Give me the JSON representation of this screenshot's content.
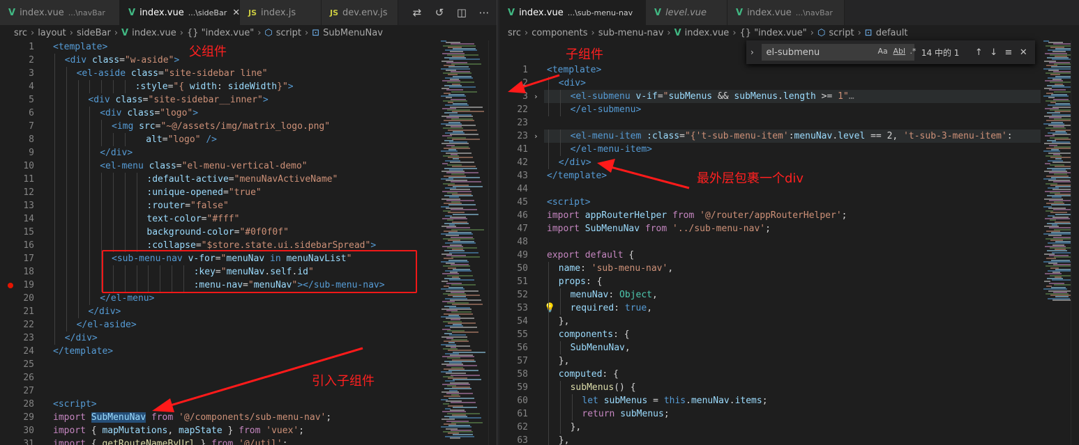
{
  "left": {
    "tabs": [
      {
        "name": "index.vue",
        "desc": "...\\navBar",
        "icon": "vue-icon",
        "active": false
      },
      {
        "name": "index.vue",
        "desc": "...\\sideBar",
        "icon": "vue-icon",
        "active": true,
        "close": "✕"
      },
      {
        "name": "index.js",
        "desc": "",
        "icon": "js-icon",
        "active": false
      },
      {
        "name": "dev.env.js",
        "desc": "",
        "icon": "js-icon",
        "active": false
      }
    ],
    "breadcrumb": [
      "src",
      "layout",
      "sideBar",
      "index.vue",
      "{} \"index.vue\"",
      "script",
      "SubMenuNav"
    ],
    "annotations": {
      "parent": "父组件",
      "import_child": "引入子组件"
    },
    "lines": [
      {
        "n": "1",
        "indent": 0,
        "tokens": [
          [
            "t-tag",
            "<template>"
          ]
        ]
      },
      {
        "n": "2",
        "indent": 1,
        "tokens": [
          [
            "t-tag",
            "<div "
          ],
          [
            "t-attr",
            "class"
          ],
          [
            "t-txt",
            "="
          ],
          [
            "t-str",
            "\"w-aside\""
          ],
          [
            "t-tag",
            ">"
          ]
        ]
      },
      {
        "n": "3",
        "indent": 2,
        "tokens": [
          [
            "t-tag",
            "<el-aside "
          ],
          [
            "t-attr",
            "class"
          ],
          [
            "t-txt",
            "="
          ],
          [
            "t-str",
            "\"site-sidebar line\""
          ]
        ]
      },
      {
        "n": "4",
        "indent": 7,
        "tokens": [
          [
            "t-attr",
            ":style"
          ],
          [
            "t-txt",
            "="
          ],
          [
            "t-str",
            "\"{ "
          ],
          [
            "t-id",
            "width"
          ],
          [
            "t-txt",
            ": "
          ],
          [
            "t-id",
            "sideWidth"
          ],
          [
            "t-str",
            "}\""
          ],
          [
            "t-tag",
            ">"
          ]
        ]
      },
      {
        "n": "5",
        "indent": 3,
        "tokens": [
          [
            "t-tag",
            "<div "
          ],
          [
            "t-attr",
            "class"
          ],
          [
            "t-txt",
            "="
          ],
          [
            "t-str",
            "\"site-sidebar__inner\""
          ],
          [
            "t-tag",
            ">"
          ]
        ]
      },
      {
        "n": "6",
        "indent": 4,
        "tokens": [
          [
            "t-tag",
            "<div "
          ],
          [
            "t-attr",
            "class"
          ],
          [
            "t-txt",
            "="
          ],
          [
            "t-str",
            "\"logo\""
          ],
          [
            "t-tag",
            ">"
          ]
        ]
      },
      {
        "n": "7",
        "indent": 5,
        "tokens": [
          [
            "t-tag",
            "<img "
          ],
          [
            "t-attr",
            "src"
          ],
          [
            "t-txt",
            "="
          ],
          [
            "t-str",
            "\"~@/assets/img/matrix_logo.png\""
          ]
        ]
      },
      {
        "n": "8",
        "indent": 7,
        "tokens": [
          [
            "t-attr",
            "  alt"
          ],
          [
            "t-txt",
            "="
          ],
          [
            "t-str",
            "\"logo\""
          ],
          [
            "t-tag",
            " />"
          ]
        ]
      },
      {
        "n": "9",
        "indent": 4,
        "tokens": [
          [
            "t-tag",
            "</div>"
          ]
        ]
      },
      {
        "n": "10",
        "indent": 4,
        "tokens": [
          [
            "t-tag",
            "<el-menu "
          ],
          [
            "t-attr",
            "class"
          ],
          [
            "t-txt",
            "="
          ],
          [
            "t-str",
            "\"el-menu-vertical-demo\""
          ]
        ]
      },
      {
        "n": "11",
        "indent": 8,
        "tokens": [
          [
            "t-attr",
            ":default-active"
          ],
          [
            "t-txt",
            "="
          ],
          [
            "t-str",
            "\"menuNavActiveName\""
          ]
        ]
      },
      {
        "n": "12",
        "indent": 8,
        "tokens": [
          [
            "t-attr",
            ":unique-opened"
          ],
          [
            "t-txt",
            "="
          ],
          [
            "t-str",
            "\"true\""
          ]
        ]
      },
      {
        "n": "13",
        "indent": 8,
        "tokens": [
          [
            "t-attr",
            ":router"
          ],
          [
            "t-txt",
            "="
          ],
          [
            "t-str",
            "\"false\""
          ]
        ]
      },
      {
        "n": "14",
        "indent": 8,
        "tokens": [
          [
            "t-attr",
            "text-color"
          ],
          [
            "t-txt",
            "="
          ],
          [
            "t-str",
            "\"#fff\""
          ]
        ]
      },
      {
        "n": "15",
        "indent": 8,
        "tokens": [
          [
            "t-attr",
            "background-color"
          ],
          [
            "t-txt",
            "="
          ],
          [
            "t-str",
            "\"#0f0f0f\""
          ]
        ]
      },
      {
        "n": "16",
        "indent": 8,
        "tokens": [
          [
            "t-attr",
            ":collapse"
          ],
          [
            "t-txt",
            "="
          ],
          [
            "t-str",
            "\"$store.state.ui.sidebarSpread\""
          ],
          [
            "t-tag",
            ">"
          ]
        ]
      },
      {
        "n": "17",
        "indent": 5,
        "tokens": [
          [
            "t-tag",
            "<sub-menu-nav "
          ],
          [
            "t-attr",
            "v-for"
          ],
          [
            "t-txt",
            "="
          ],
          [
            "t-str",
            "\""
          ],
          [
            "t-id",
            "menuNav"
          ],
          [
            "t-kw2",
            " in "
          ],
          [
            "t-id",
            "menuNavList"
          ],
          [
            "t-str",
            "\""
          ]
        ]
      },
      {
        "n": "18",
        "indent": 12,
        "tokens": [
          [
            "t-attr",
            ":key"
          ],
          [
            "t-txt",
            "="
          ],
          [
            "t-str",
            "\""
          ],
          [
            "t-id",
            "menuNav"
          ],
          [
            "t-txt",
            "."
          ],
          [
            "t-id",
            "self"
          ],
          [
            "t-txt",
            "."
          ],
          [
            "t-id",
            "id"
          ],
          [
            "t-str",
            "\""
          ]
        ]
      },
      {
        "n": "19",
        "indent": 12,
        "tokens": [
          [
            "t-attr",
            ":menu-nav"
          ],
          [
            "t-txt",
            "="
          ],
          [
            "t-str",
            "\""
          ],
          [
            "t-id",
            "menuNav"
          ],
          [
            "t-str",
            "\""
          ],
          [
            "t-tag",
            "></sub-menu-nav>"
          ]
        ]
      },
      {
        "n": "20",
        "indent": 4,
        "tokens": [
          [
            "t-tag",
            "</el-menu>"
          ]
        ]
      },
      {
        "n": "21",
        "indent": 3,
        "tokens": [
          [
            "t-tag",
            "</div>"
          ]
        ]
      },
      {
        "n": "22",
        "indent": 2,
        "tokens": [
          [
            "t-tag",
            "</el-aside>"
          ]
        ]
      },
      {
        "n": "23",
        "indent": 1,
        "tokens": [
          [
            "t-tag",
            "</div>"
          ]
        ]
      },
      {
        "n": "24",
        "indent": 0,
        "tokens": [
          [
            "t-tag",
            "</template>"
          ]
        ]
      },
      {
        "n": "25",
        "indent": 0,
        "tokens": []
      },
      {
        "n": "26",
        "indent": 0,
        "tokens": []
      },
      {
        "n": "27",
        "indent": 0,
        "tokens": []
      },
      {
        "n": "28",
        "indent": 0,
        "tokens": [
          [
            "t-tag",
            "<script>"
          ]
        ]
      },
      {
        "n": "29",
        "indent": 0,
        "tokens": [
          [
            "t-kw",
            "import "
          ],
          [
            "t-id sel",
            "SubMenuNav"
          ],
          [
            "t-kw",
            " from "
          ],
          [
            "t-str",
            "'@/components/sub-menu-nav'"
          ],
          [
            "t-txt",
            ";"
          ]
        ]
      },
      {
        "n": "30",
        "indent": 0,
        "tokens": [
          [
            "t-kw",
            "import "
          ],
          [
            "t-txt",
            "{ "
          ],
          [
            "t-id",
            "mapMutations"
          ],
          [
            "t-txt",
            ", "
          ],
          [
            "t-id",
            "mapState"
          ],
          [
            "t-txt",
            " } "
          ],
          [
            "t-kw",
            "from "
          ],
          [
            "t-str",
            "'vuex'"
          ],
          [
            "t-txt",
            ";"
          ]
        ]
      },
      {
        "n": "31",
        "indent": 0,
        "tokens": [
          [
            "t-kw",
            "import "
          ],
          [
            "t-txt",
            "{ "
          ],
          [
            "t-fn",
            "getRouteNameByUrl"
          ],
          [
            "t-txt",
            " } "
          ],
          [
            "t-kw",
            "from "
          ],
          [
            "t-str",
            "'@/util'"
          ],
          [
            "t-txt",
            ";"
          ]
        ]
      }
    ]
  },
  "right": {
    "tabs": [
      {
        "name": "index.vue",
        "desc": "...\\sub-menu-nav",
        "icon": "vue-icon",
        "active": true
      },
      {
        "name": "level.vue",
        "desc": "",
        "icon": "vue-icon",
        "active": false,
        "italic": true
      },
      {
        "name": "index.vue",
        "desc": "...\\navBar",
        "icon": "vue-icon",
        "active": false
      }
    ],
    "breadcrumb": [
      "src",
      "components",
      "sub-menu-nav",
      "index.vue",
      "{} \"index.vue\"",
      "script",
      "default"
    ],
    "find": {
      "query": "el-submenu",
      "count": "14 中的 1",
      "opt_case": "Aa",
      "opt_word": "Abl",
      "opt_regex": ".*"
    },
    "annotations": {
      "child": "子组件",
      "outer_div": "最外层包裹一个div"
    },
    "lines": [
      {
        "n": "1",
        "indent": 0,
        "tokens": [
          [
            "t-tag",
            "<template>"
          ]
        ]
      },
      {
        "n": "2",
        "indent": 1,
        "tokens": [
          [
            "t-tag",
            "<div>"
          ]
        ]
      },
      {
        "n": "3",
        "indent": 2,
        "fold": true,
        "tokens": [
          [
            "t-tag",
            "<el-submenu "
          ],
          [
            "t-attr",
            "v-if"
          ],
          [
            "t-txt",
            "="
          ],
          [
            "t-str",
            "\""
          ],
          [
            "t-id",
            "subMenus"
          ],
          [
            "t-txt",
            " && "
          ],
          [
            "t-id",
            "subMenus"
          ],
          [
            "t-txt",
            "."
          ],
          [
            "t-id",
            "length"
          ],
          [
            "t-txt",
            " >= "
          ],
          [
            "t-str",
            "1\""
          ],
          [
            "t-gray",
            "…"
          ]
        ]
      },
      {
        "n": "22",
        "indent": 2,
        "tokens": [
          [
            "t-tag",
            "</el-submenu>"
          ]
        ]
      },
      {
        "n": "23",
        "indent": 0,
        "tokens": []
      },
      {
        "n": "23",
        "indent": 2,
        "fold": true,
        "tokens": [
          [
            "t-tag",
            "<el-menu-item "
          ],
          [
            "t-attr",
            ":class"
          ],
          [
            "t-txt",
            "="
          ],
          [
            "t-str",
            "\"{"
          ],
          [
            "t-str",
            "'t-sub-menu-item'"
          ],
          [
            "t-txt",
            ":"
          ],
          [
            "t-id",
            "menuNav"
          ],
          [
            "t-txt",
            "."
          ],
          [
            "t-id",
            "level"
          ],
          [
            "t-txt",
            " == 2, "
          ],
          [
            "t-str",
            "'t-sub-3-menu-item'"
          ],
          [
            "t-txt",
            ":"
          ]
        ]
      },
      {
        "n": "41",
        "indent": 2,
        "tokens": [
          [
            "t-tag",
            "</el-menu-item>"
          ]
        ]
      },
      {
        "n": "42",
        "indent": 1,
        "tokens": [
          [
            "t-tag",
            "</div>"
          ]
        ]
      },
      {
        "n": "43",
        "indent": 0,
        "tokens": [
          [
            "t-tag",
            "</template>"
          ]
        ]
      },
      {
        "n": "44",
        "indent": 0,
        "tokens": []
      },
      {
        "n": "45",
        "indent": 0,
        "tokens": [
          [
            "t-tag",
            "<script>"
          ]
        ]
      },
      {
        "n": "46",
        "indent": 0,
        "tokens": [
          [
            "t-kw",
            "import "
          ],
          [
            "t-id",
            "appRouterHelper"
          ],
          [
            "t-kw",
            " from "
          ],
          [
            "t-str",
            "'@/router/appRouterHelper'"
          ],
          [
            "t-txt",
            ";"
          ]
        ]
      },
      {
        "n": "47",
        "indent": 0,
        "tokens": [
          [
            "t-kw",
            "import "
          ],
          [
            "t-id",
            "SubMenuNav"
          ],
          [
            "t-kw",
            " from "
          ],
          [
            "t-str",
            "'../sub-menu-nav'"
          ],
          [
            "t-txt",
            ";"
          ]
        ]
      },
      {
        "n": "48",
        "indent": 0,
        "tokens": []
      },
      {
        "n": "49",
        "indent": 0,
        "tokens": [
          [
            "t-kw",
            "export "
          ],
          [
            "t-kw",
            "default "
          ],
          [
            "t-txt",
            "{"
          ]
        ]
      },
      {
        "n": "50",
        "indent": 1,
        "tokens": [
          [
            "t-id",
            "name"
          ],
          [
            "t-txt",
            ": "
          ],
          [
            "t-str",
            "'sub-menu-nav'"
          ],
          [
            "t-txt",
            ","
          ]
        ]
      },
      {
        "n": "51",
        "indent": 1,
        "tokens": [
          [
            "t-id",
            "props"
          ],
          [
            "t-txt",
            ": {"
          ]
        ]
      },
      {
        "n": "52",
        "indent": 2,
        "tokens": [
          [
            "t-id",
            "menuNav"
          ],
          [
            "t-txt",
            ": "
          ],
          [
            "t-type",
            "Object"
          ],
          [
            "t-txt",
            ","
          ]
        ]
      },
      {
        "n": "53",
        "indent": 2,
        "bulb": true,
        "tokens": [
          [
            "t-id",
            "required"
          ],
          [
            "t-txt",
            ": "
          ],
          [
            "t-kw2",
            "true"
          ],
          [
            "t-txt",
            ","
          ]
        ]
      },
      {
        "n": "54",
        "indent": 1,
        "tokens": [
          [
            "t-txt",
            "},"
          ]
        ]
      },
      {
        "n": "55",
        "indent": 1,
        "tokens": [
          [
            "t-id",
            "components"
          ],
          [
            "t-txt",
            ": {"
          ]
        ]
      },
      {
        "n": "56",
        "indent": 2,
        "tokens": [
          [
            "t-id",
            "SubMenuNav"
          ],
          [
            "t-txt",
            ","
          ]
        ]
      },
      {
        "n": "57",
        "indent": 1,
        "tokens": [
          [
            "t-txt",
            "},"
          ]
        ]
      },
      {
        "n": "58",
        "indent": 1,
        "tokens": [
          [
            "t-id",
            "computed"
          ],
          [
            "t-txt",
            ": {"
          ]
        ]
      },
      {
        "n": "59",
        "indent": 2,
        "tokens": [
          [
            "t-fn",
            "subMenus"
          ],
          [
            "t-txt",
            "() {"
          ]
        ]
      },
      {
        "n": "60",
        "indent": 3,
        "tokens": [
          [
            "t-kw2",
            "let "
          ],
          [
            "t-id",
            "subMenus"
          ],
          [
            "t-txt",
            " = "
          ],
          [
            "t-kw2",
            "this"
          ],
          [
            "t-txt",
            "."
          ],
          [
            "t-id",
            "menuNav"
          ],
          [
            "t-txt",
            "."
          ],
          [
            "t-id",
            "items"
          ],
          [
            "t-txt",
            ";"
          ]
        ]
      },
      {
        "n": "61",
        "indent": 3,
        "tokens": [
          [
            "t-kw",
            "return "
          ],
          [
            "t-id",
            "subMenus"
          ],
          [
            "t-txt",
            ";"
          ]
        ]
      },
      {
        "n": "62",
        "indent": 2,
        "tokens": [
          [
            "t-txt",
            "},"
          ]
        ]
      },
      {
        "n": "63",
        "indent": 1,
        "tokens": [
          [
            "t-txt",
            "},"
          ]
        ]
      }
    ]
  },
  "colors": {
    "annotation": "#ff2020",
    "vue_icon": "#41b883",
    "js_icon": "#cbcb41"
  }
}
